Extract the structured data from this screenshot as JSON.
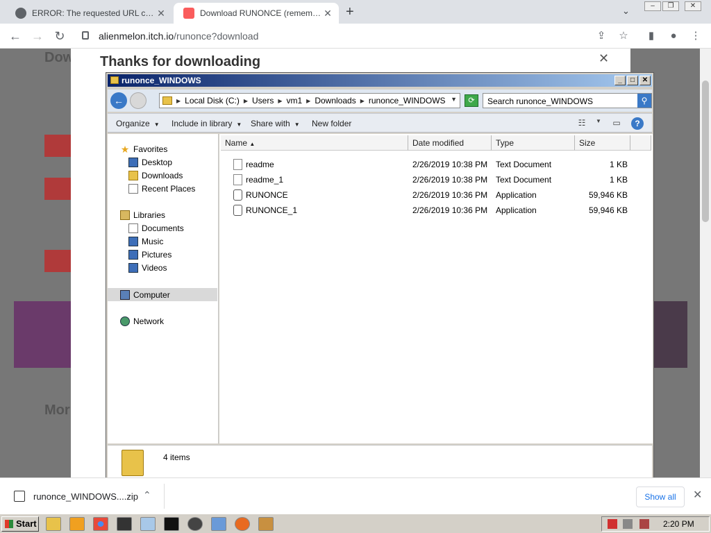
{
  "browser": {
    "tabs": [
      {
        "title": "ERROR: The requested URL could n"
      },
      {
        "title": "Download RUNONCE (remember_m"
      }
    ],
    "new_tab": "+",
    "url_host": "alienmelon.itch.io",
    "url_path": "/runonce?download"
  },
  "page": {
    "modal_title": "Thanks for downloading",
    "bg_heading": "Dow",
    "bg_more": "Mor"
  },
  "explorer": {
    "title": "runonce_WINDOWS",
    "breadcrumbs": [
      "Local Disk (C:)",
      "Users",
      "vm1",
      "Downloads",
      "runonce_WINDOWS"
    ],
    "search_placeholder": "Search runonce_WINDOWS",
    "commands": {
      "organize": "Organize",
      "include": "Include in library",
      "share": "Share with",
      "newfolder": "New folder"
    },
    "nav": {
      "favorites": "Favorites",
      "desktop": "Desktop",
      "downloads": "Downloads",
      "recent": "Recent Places",
      "libraries": "Libraries",
      "documents": "Documents",
      "music": "Music",
      "pictures": "Pictures",
      "videos": "Videos",
      "computer": "Computer",
      "network": "Network"
    },
    "columns": {
      "name": "Name",
      "date": "Date modified",
      "type": "Type",
      "size": "Size"
    },
    "files": [
      {
        "name": "readme",
        "date": "2/26/2019 10:38 PM",
        "type": "Text Document",
        "size": "1 KB"
      },
      {
        "name": "readme_1",
        "date": "2/26/2019 10:38 PM",
        "type": "Text Document",
        "size": "1 KB"
      },
      {
        "name": "RUNONCE",
        "date": "2/26/2019 10:36 PM",
        "type": "Application",
        "size": "59,946 KB"
      },
      {
        "name": "RUNONCE_1",
        "date": "2/26/2019 10:36 PM",
        "type": "Application",
        "size": "59,946 KB"
      }
    ],
    "status": "4 items"
  },
  "downloads": {
    "file": "runonce_WINDOWS....zip",
    "show_all": "Show all"
  },
  "taskbar": {
    "start": "Start",
    "clock": "2:20 PM"
  }
}
